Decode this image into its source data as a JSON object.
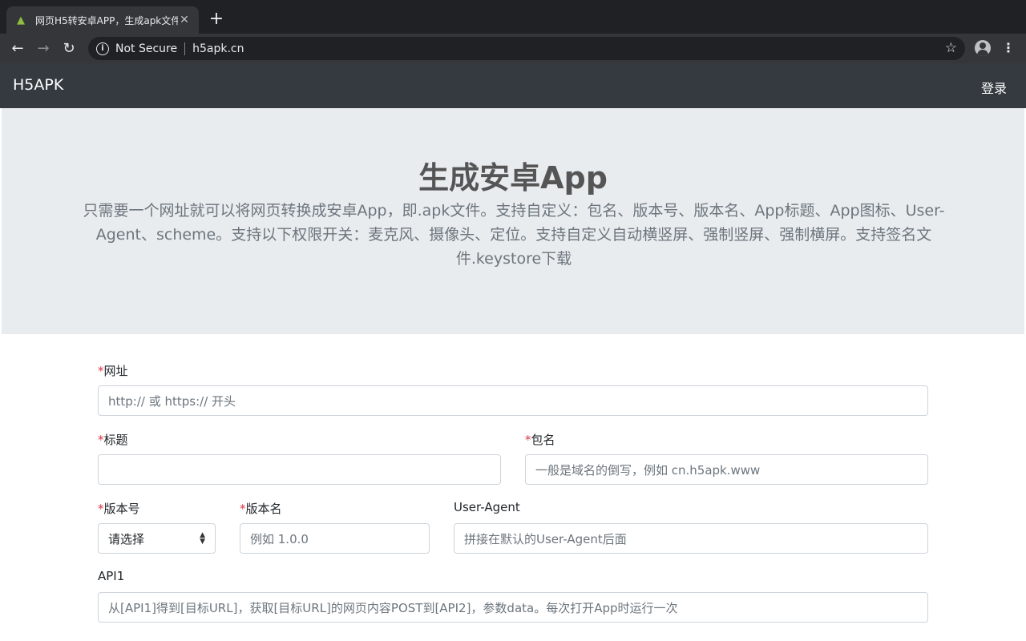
{
  "browser": {
    "tab_title": "网页H5转安卓APP，生成apk文件",
    "security_label": "Not Secure",
    "url": "h5apk.cn"
  },
  "site": {
    "brand": "H5APK",
    "login": "登录"
  },
  "hero": {
    "title": "生成安卓App",
    "description": "只需要一个网址就可以将网页转换成安卓App，即.apk文件。支持自定义：包名、版本号、版本名、App标题、App图标、User-Agent、scheme。支持以下权限开关：麦克风、摄像头、定位。支持自定义自动横竖屏、强制竖屏、强制横屏。支持签名文件.keystore下载"
  },
  "form": {
    "required_mark": "*",
    "url": {
      "label": "网址",
      "placeholder": "http:// 或 https:// 开头"
    },
    "title": {
      "label": "标题",
      "placeholder": ""
    },
    "package": {
      "label": "包名",
      "placeholder": "一般是域名的倒写，例如 cn.h5apk.www"
    },
    "version_code": {
      "label": "版本号",
      "selected": "请选择"
    },
    "version_name": {
      "label": "版本名",
      "placeholder": "例如 1.0.0"
    },
    "user_agent": {
      "label": "User-Agent",
      "placeholder": "拼接在默认的User-Agent后面"
    },
    "api1": {
      "label": "API1",
      "placeholder": "从[API1]得到[目标URL]，获取[目标URL]的网页内容POST到[API2]，参数data。每次打开App时运行一次"
    }
  }
}
